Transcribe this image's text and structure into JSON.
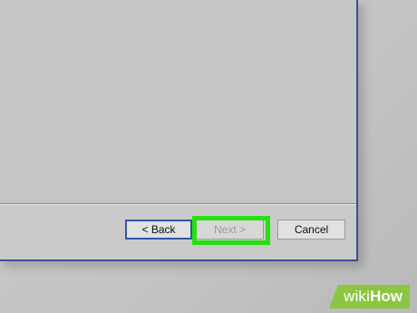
{
  "wizard": {
    "back_label": "< Back",
    "next_label": "Next >",
    "cancel_label": "Cancel",
    "next_disabled": true
  },
  "highlight": {
    "color": "#26e011",
    "target": "next-button"
  },
  "watermark": {
    "prefix": "wiki",
    "suffix": "How",
    "color": "#8cc640"
  },
  "colors": {
    "window_border": "#3c4f9e",
    "focused_button_border": "#2f57a8",
    "disabled_text": "#9b9b9b"
  }
}
